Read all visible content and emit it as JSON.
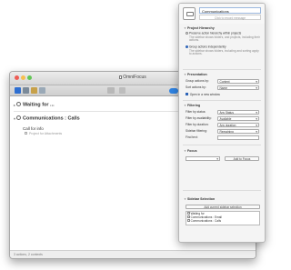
{
  "window": {
    "title": "OmniFocus",
    "toolbar": {
      "perspective_icon": "perspectives-icon",
      "inbox_icon": "inbox-icon",
      "projects_icon": "projects-icon",
      "contexts_icon": "contexts-icon",
      "view_icon": "view-options-icon",
      "flag_icon": "flag-icon",
      "inspector_icon": "inspector-toggle-icon"
    },
    "groups": [
      {
        "label": "Waiting for ..."
      },
      {
        "label": "Communications : Calls"
      }
    ],
    "task": {
      "title": "Call for info",
      "note": "Project for Attachments"
    },
    "status": "3 actions, 2 contexts"
  },
  "inspector": {
    "name_value": "Communications",
    "name_sub": "Click to record message",
    "project_hierarchy": {
      "header": "Project Hierarchy",
      "options": [
        {
          "label": "Preserve action hierarchy within projects",
          "desc": "The sidebar shows folders, and projects, including their actions.",
          "selected": false
        },
        {
          "label": "Group actions independently",
          "desc": "The sidebar shows folders, including and sorting apply to actions.",
          "selected": true
        }
      ]
    },
    "presentation": {
      "header": "Presentation",
      "rows": [
        {
          "label": "Group actions by:",
          "value": "Context"
        },
        {
          "label": "Sort actions by:",
          "value": "Name"
        }
      ],
      "checkbox_label": "Open in a new window"
    },
    "filtering": {
      "header": "Filtering",
      "rows": [
        {
          "label": "Filter by status:",
          "value": "Any Status"
        },
        {
          "label": "Filter by availability:",
          "value": "Available"
        },
        {
          "label": "Filter by duration:",
          "value": "Any duration"
        },
        {
          "label": "Sidebar filtering:",
          "value": "Remaining"
        }
      ],
      "find_label": "Find text:"
    },
    "focus": {
      "header": "Focus",
      "add_label": "Add to Focus"
    },
    "sidebar_selection": {
      "header": "Sidebar Selection",
      "add_label": "Add current sidebar selection",
      "items": [
        "Waiting for",
        "Communications : Email",
        "Communications : Calls"
      ]
    }
  }
}
